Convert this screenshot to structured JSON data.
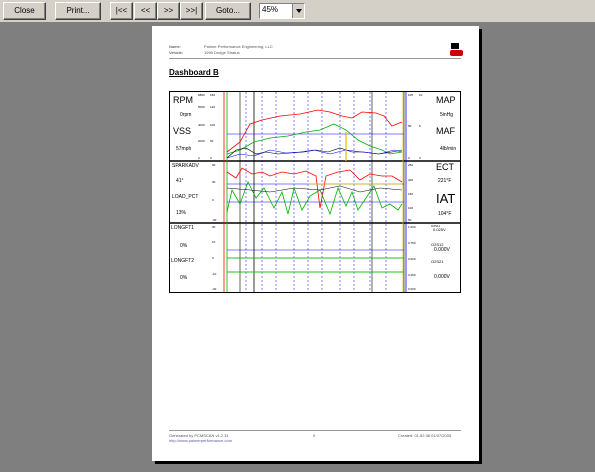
{
  "toolbar": {
    "close": "Close",
    "print": "Print...",
    "first": "|<<",
    "prev": "<<",
    "next": ">>",
    "last": ">>|",
    "goto": "Goto...",
    "zoom": "45%"
  },
  "report": {
    "name_label": "Name:",
    "name_value": "Palmer Performance Engineering, LLC",
    "vehicle_label": "Vehicle:",
    "vehicle_value": "1999 Dodge Stratus",
    "title": "Dashboard B",
    "footer_left1": "Generated by PCMSCAN v1.2.31",
    "footer_left2": "http://www.palmerperformance.com",
    "footer_page": "0",
    "footer_right": "Created: 01:52:38 01/07/2005"
  },
  "panels": {
    "rpm": {
      "name": "RPM",
      "value": "0rpm"
    },
    "vss": {
      "name": "VSS",
      "value": "57mph"
    },
    "map": {
      "name": "MAP",
      "value": "5inHg"
    },
    "maf": {
      "name": "MAF",
      "value": "4lb/min"
    },
    "sparkadv": {
      "name": "SPARKADV",
      "value": "41°"
    },
    "load_pct": {
      "name": "LOAD_PCT",
      "value": "13%"
    },
    "ect": {
      "name": "ECT",
      "value": "221°F"
    },
    "iat": {
      "name": "IAT",
      "value": "104°F"
    },
    "longft1": {
      "name": "LONGFT1",
      "value": "0%"
    },
    "longft2": {
      "name": "LONGFT2",
      "value": "0%"
    },
    "o2s11": {
      "name": "O2S11",
      "value": "0.025V"
    },
    "o2s12": {
      "name": "O2S12",
      "value": "0.000V"
    },
    "o2s21": {
      "name": "O2S21",
      "value": "0.000V"
    }
  },
  "axis_ticks": {
    "rpm": [
      "6800",
      "5000",
      "4000",
      "3000",
      "2000",
      "1000",
      "0"
    ],
    "vss": [
      "160",
      "120",
      "100",
      "80",
      "60",
      "40",
      "0"
    ],
    "map": [
      "105",
      "50",
      "0"
    ],
    "maf": [
      "10",
      "5",
      "0"
    ],
    "spark": [
      "60",
      "45",
      "30",
      "15",
      "0",
      "-15",
      "-30"
    ],
    "load": [
      "100",
      "75",
      "50",
      "25",
      "0"
    ],
    "ect": [
      "250",
      "200",
      "150",
      "100",
      "50"
    ],
    "ltft": [
      "30",
      "20",
      "10",
      "0",
      "-10",
      "-20",
      "-30"
    ],
    "o2": [
      "1.000",
      "0.875",
      "0.750",
      "0.625",
      "0.500",
      "0.375",
      "0.250",
      "0.125",
      "0.000"
    ]
  },
  "colors": {
    "rpm": "#ff0000",
    "vss": "#00c000",
    "map": "#0000ff",
    "maf": "#000000",
    "marker": "#ffff00"
  }
}
